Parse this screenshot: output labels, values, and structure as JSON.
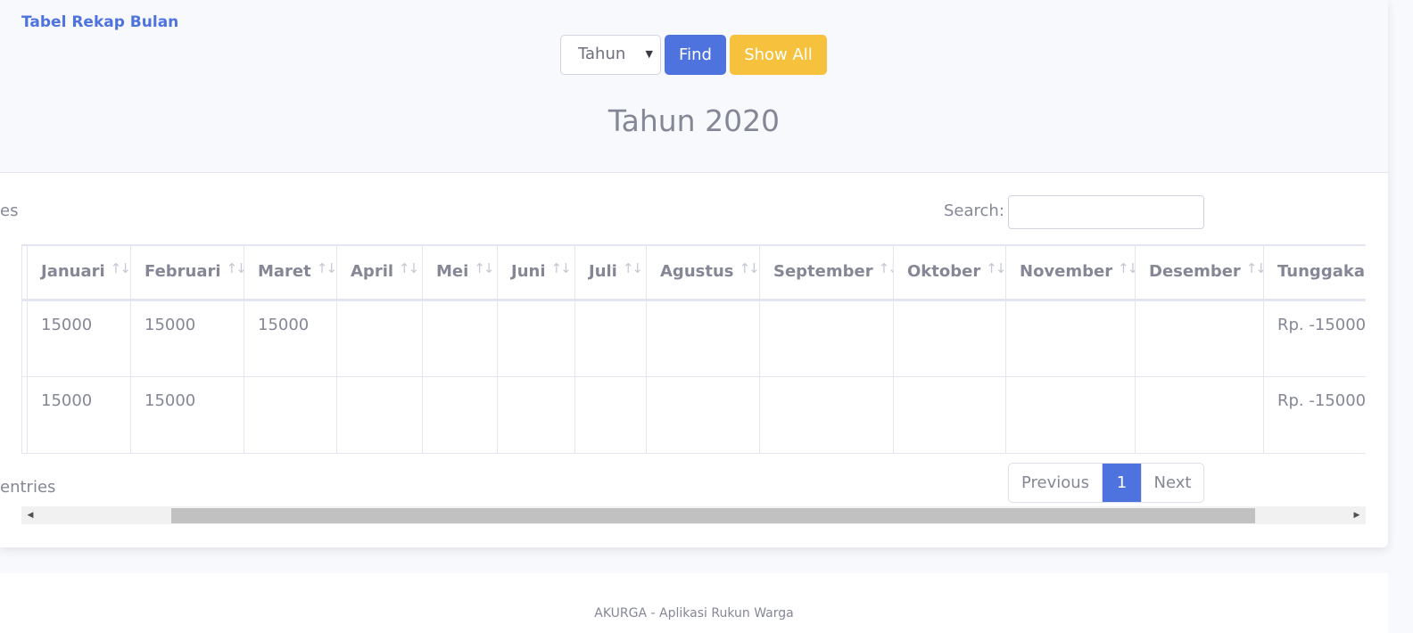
{
  "header": {
    "title": "Tabel Rekap Bulan",
    "select_value": "Tahun",
    "find_label": "Find",
    "show_all_label": "Show All",
    "year_title": "Tahun 2020"
  },
  "table_controls": {
    "length_label_partial": "es",
    "search_label": "Search:",
    "search_value": ""
  },
  "table": {
    "columns": [
      "Januari",
      "Februari",
      "Maret",
      "April",
      "Mei",
      "Juni",
      "Juli",
      "Agustus",
      "September",
      "Oktober",
      "November",
      "Desember",
      "Tunggakan"
    ],
    "rows": [
      [
        "15000",
        "15000",
        "15000",
        "",
        "",
        "",
        "",
        "",
        "",
        "",
        "",
        "",
        "Rp. -15000"
      ],
      [
        "15000",
        "15000",
        "",
        "",
        "",
        "",
        "",
        "",
        "",
        "",
        "",
        "",
        "Rp. -15000"
      ]
    ]
  },
  "footer_controls": {
    "info_partial": "entries",
    "pagination": {
      "previous": "Previous",
      "current": "1",
      "next": "Next"
    }
  },
  "footer": {
    "text": "AKURGA - Aplikasi Rukun Warga"
  },
  "colors": {
    "primary": "#4e73df",
    "warning": "#f6c23e",
    "text": "#858796"
  },
  "icons": {
    "sort": "sort-arrows-icon",
    "select": "caret-down-icon",
    "scroll_left": "triangle-left-icon",
    "scroll_right": "triangle-right-icon"
  }
}
